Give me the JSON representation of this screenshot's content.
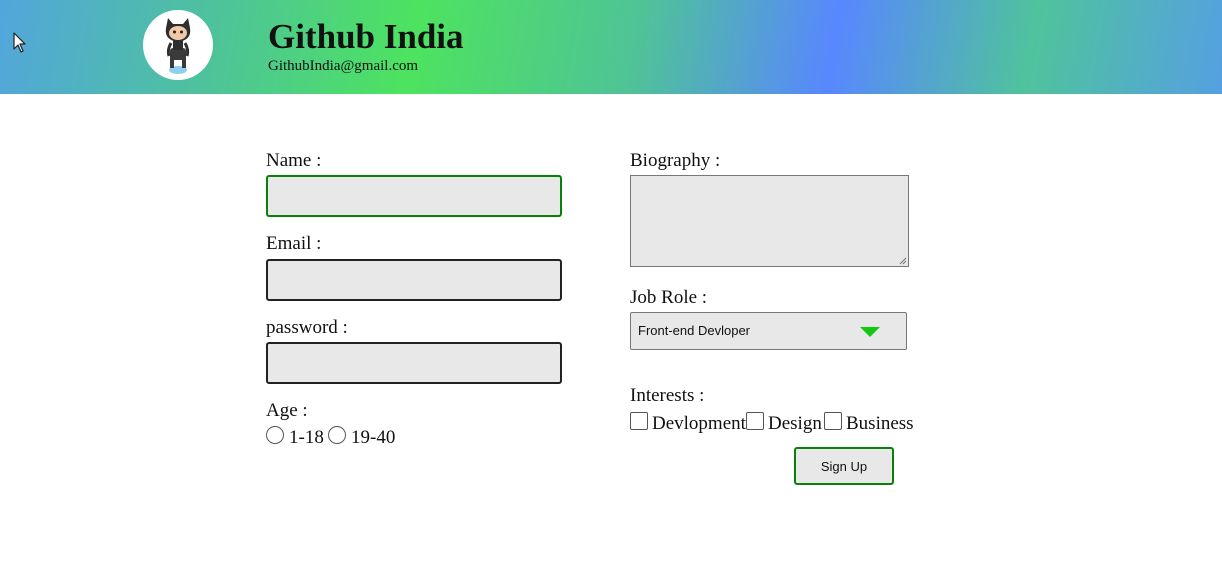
{
  "header": {
    "title": "Github India",
    "email": "GithubIndia@gmail.com",
    "logo_icon": "octocat-icon"
  },
  "form": {
    "name_label": "Name :",
    "email_label": "Email :",
    "password_label": "password :",
    "age_label": "Age :",
    "age_options": [
      "1-18",
      "19-40"
    ],
    "biography_label": "Biography :",
    "job_role_label": "Job Role :",
    "job_role_selected": "Front-end Devloper",
    "interests_label": "Interests :",
    "interest_options": [
      "Devlopment",
      "Design",
      "Business"
    ],
    "submit_label": "Sign Up"
  },
  "colors": {
    "accent_green": "#0a7f0a",
    "dropdown_arrow": "#11c911",
    "input_background": "#e8e8e8"
  }
}
